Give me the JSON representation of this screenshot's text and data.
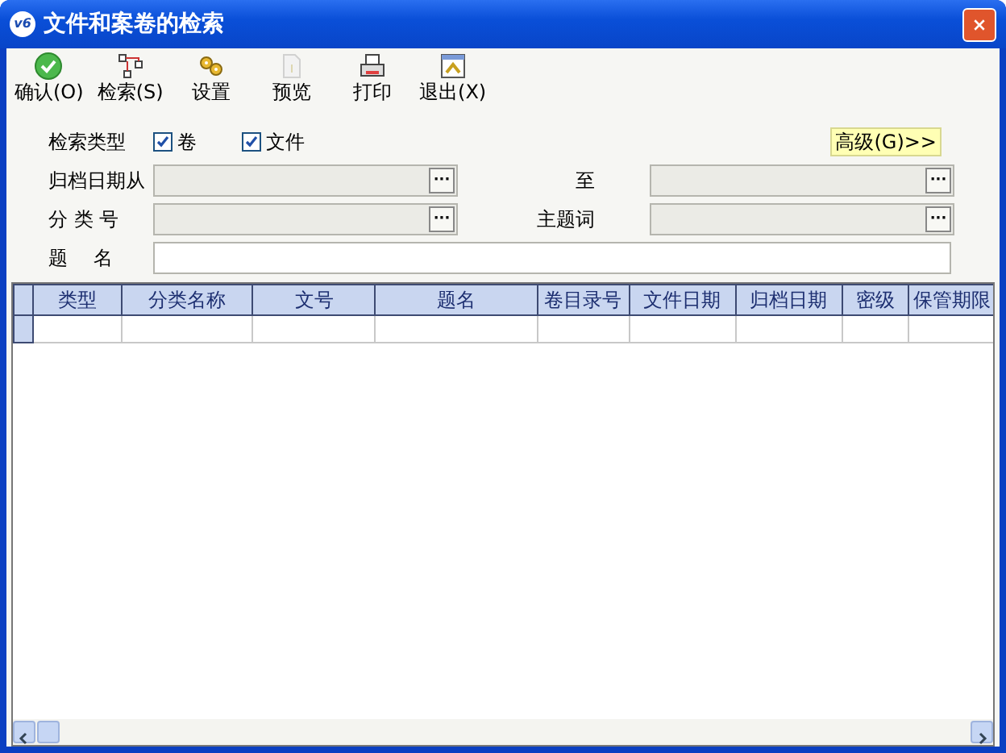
{
  "window": {
    "title": "文件和案卷的检索",
    "badge": "v6"
  },
  "toolbar": [
    {
      "label": "确认(O)",
      "disabled": false
    },
    {
      "label": "检索(S)",
      "disabled": false
    },
    {
      "label": "设置",
      "disabled": false
    },
    {
      "label": "预览",
      "disabled": true
    },
    {
      "label": "打印",
      "disabled": false
    },
    {
      "label": "退出(X)",
      "disabled": false
    }
  ],
  "search_type": {
    "label": "检索类型",
    "options": [
      {
        "label": "卷",
        "checked": true
      },
      {
        "label": "文件",
        "checked": true
      }
    ]
  },
  "advanced_button": "高级(G)>>",
  "fields": [
    {
      "label": "归档日期从",
      "kind": "picker",
      "label2": "至"
    },
    {
      "label": "分 类 号",
      "kind": "picker",
      "label2": "主题词"
    },
    {
      "label": "题　 名",
      "kind": "text"
    }
  ],
  "ellipsis": "···",
  "table": {
    "columns": [
      "类型",
      "分类名称",
      "文号",
      "题名",
      "卷目录号",
      "文件日期",
      "归档日期",
      "密级",
      "保管期限"
    ]
  }
}
